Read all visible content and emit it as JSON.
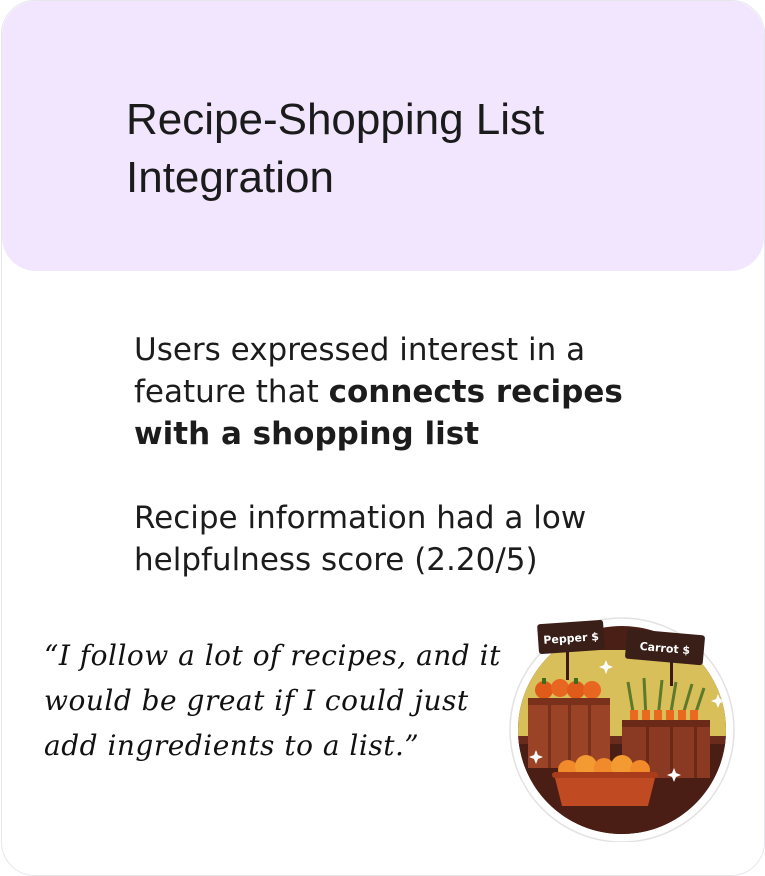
{
  "card": {
    "title": "Recipe-Shopping List Integration",
    "finding_1": {
      "prefix": "Users expressed interest in a feature that ",
      "emphasis": "connects recipes with a shopping list"
    },
    "finding_2": "Recipe information had a low helpfulness score (2.20/5)",
    "quote": "“I follow a lot of recipes, and it would be great if I could just add ingredients to a list.”",
    "illustration": {
      "sign_left": "Pepper $",
      "sign_right": "Carrot $"
    }
  },
  "colors": {
    "header_bg": "#f1e6fd",
    "text": "#1c1c1c",
    "card_border": "#e6e6ec"
  }
}
